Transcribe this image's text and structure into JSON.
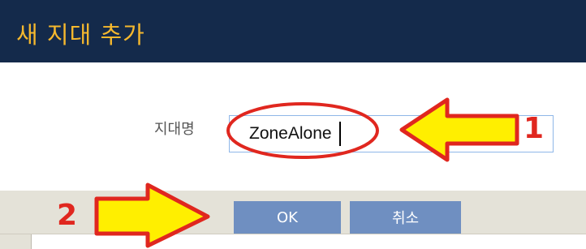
{
  "dialog": {
    "title": "새 지대 추가",
    "field_label": "지대명",
    "zone_name_value": "ZoneAlone",
    "ok_label": "OK",
    "cancel_label": "취소"
  },
  "annotations": {
    "step1": "1",
    "step2": "2"
  },
  "colors": {
    "titlebar": "#142a4b",
    "title_text": "#f5b82e",
    "button": "#6f8fc1",
    "footer": "#e4e2d8",
    "annotation_red": "#e0271f",
    "annotation_yellow": "#ffef00"
  }
}
